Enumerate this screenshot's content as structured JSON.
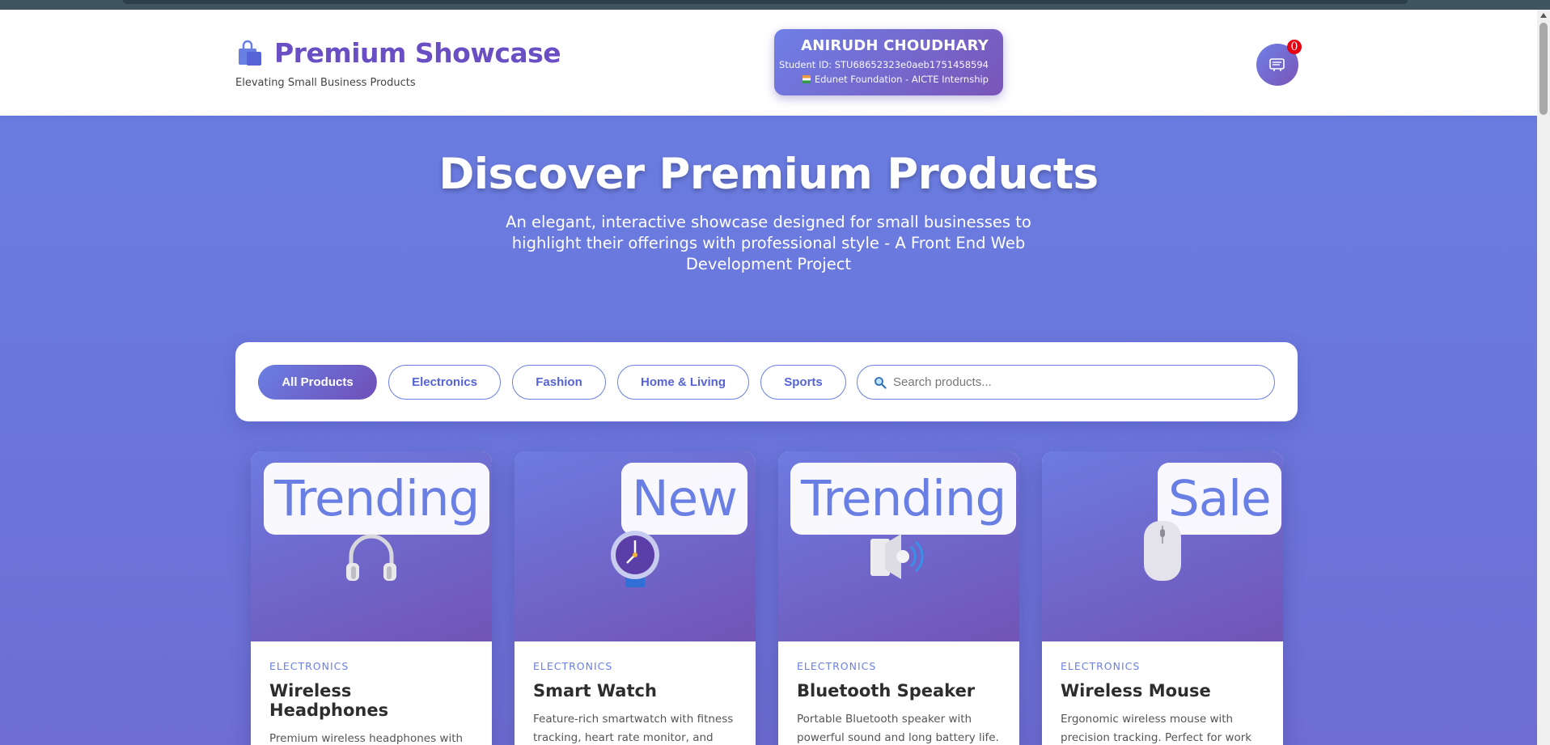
{
  "header": {
    "brand_title": "Premium Showcase",
    "brand_tagline": "Elevating Small Business Products",
    "brand_icon": "shopping-bag-icon",
    "student": {
      "name": "ANIRUDH CHOUDHARY",
      "id_text": "Student ID: STU68652323e0aeb1751458594",
      "org_text": "Edunet Foundation - AICTE Internship"
    },
    "cart": {
      "icon": "cart-icon",
      "count": "0"
    }
  },
  "hero": {
    "title": "Discover Premium Products",
    "subtitle": "An elegant, interactive showcase designed for small businesses to highlight their offerings with professional style - A Front End Web Development Project"
  },
  "filters": {
    "categories": [
      "All Products",
      "Electronics",
      "Fashion",
      "Home & Living",
      "Sports"
    ],
    "active": "All Products",
    "search_placeholder": "Search products..."
  },
  "products": [
    {
      "badge": "Trending",
      "category": "ELECTRONICS",
      "name": "Wireless Headphones",
      "description": "Premium wireless headphones with noise cancellation and exceptional",
      "icon": "headphones-icon"
    },
    {
      "badge": "New",
      "category": "ELECTRONICS",
      "name": "Smart Watch",
      "description": "Feature-rich smartwatch with fitness tracking, heart rate monitor, and",
      "icon": "watch-icon"
    },
    {
      "badge": "Trending",
      "category": "ELECTRONICS",
      "name": "Bluetooth Speaker",
      "description": "Portable Bluetooth speaker with powerful sound and long battery life.",
      "icon": "speaker-icon"
    },
    {
      "badge": "Sale",
      "category": "ELECTRONICS",
      "name": "Wireless Mouse",
      "description": "Ergonomic wireless mouse with precision tracking. Perfect for work and",
      "icon": "mouse-icon"
    }
  ],
  "colors": {
    "accent": "#6a7fe3",
    "brand_purple": "#6a4fc4",
    "badge_red": "#e60012"
  }
}
